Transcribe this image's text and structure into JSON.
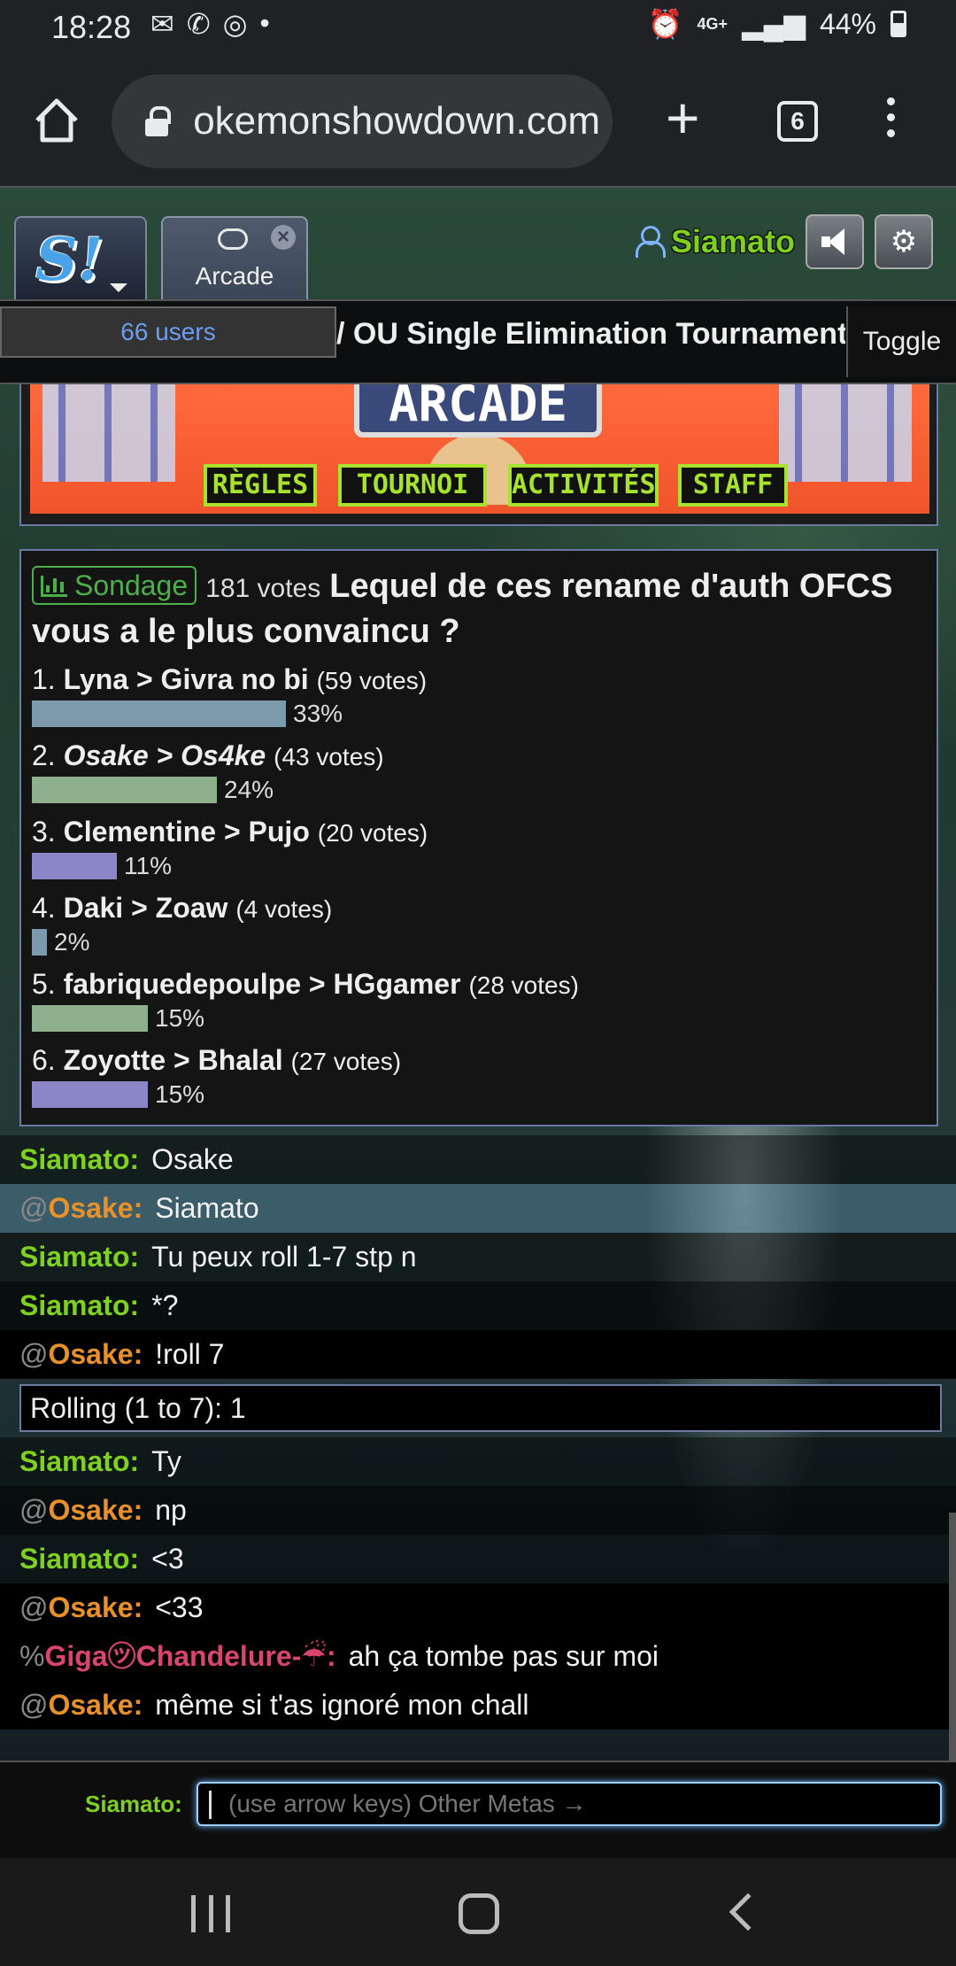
{
  "status_bar": {
    "time": "18:28",
    "notification_icons": [
      "email-icon",
      "whatsapp-icon",
      "instagram-icon",
      "dot-icon"
    ],
    "network": "4G+",
    "battery": "44%"
  },
  "browser": {
    "url": "pokemonshowdown.com",
    "tab_count": "6"
  },
  "showdown": {
    "room_tab": "Arcade",
    "username": "Siamato",
    "users_label": "66 users",
    "tournament_title": "/ OU Single Elimination Tournament",
    "toggle_label": "Toggle",
    "banner": {
      "arcade_label": "ARCADE",
      "buttons": [
        "RÈGLES",
        "TOURNOI",
        "ACTIVITÉS",
        "STAFF"
      ]
    },
    "poll": {
      "badge_label": "Sondage",
      "total_votes": "181 votes",
      "question": "Lequel de ces rename d'auth OFCS vous a le plus convaincu ?",
      "options": [
        {
          "num": "1.",
          "text": "Lyna > Givra no bi",
          "italic": false,
          "votes": "(59 votes)",
          "percent_label": "33%",
          "percent": 33,
          "color": "#7d9aad"
        },
        {
          "num": "2.",
          "text": "Osake > Os4ke",
          "italic": true,
          "votes": "(43 votes)",
          "percent_label": "24%",
          "percent": 24,
          "color": "#8fb08d"
        },
        {
          "num": "3.",
          "text": "Clementine > Pujo",
          "italic": false,
          "votes": "(20 votes)",
          "percent_label": "11%",
          "percent": 11,
          "color": "#8a86c8"
        },
        {
          "num": "4.",
          "text": "Daki > Zoaw",
          "italic": false,
          "votes": "(4 votes)",
          "percent_label": "2%",
          "percent": 2,
          "color": "#7d9aad"
        },
        {
          "num": "5.",
          "text": "fabriquedepoulpe > HGgamer",
          "italic": false,
          "votes": "(28 votes)",
          "percent_label": "15%",
          "percent": 15,
          "color": "#8fb08d"
        },
        {
          "num": "6.",
          "text": "Zoyotte > Bhalal",
          "italic": false,
          "votes": "(27 votes)",
          "percent_label": "15%",
          "percent": 15,
          "color": "#8a86c8"
        }
      ]
    },
    "chat": [
      {
        "rank": "",
        "user": "Siamato",
        "msg": "Osake"
      },
      {
        "rank": "@",
        "user": "Osake",
        "msg": "Siamato"
      },
      {
        "rank": "",
        "user": "Siamato",
        "msg": "Tu peux roll 1-7 stp n"
      },
      {
        "rank": "",
        "user": "Siamato",
        "msg": "*?"
      },
      {
        "rank": "@",
        "user": "Osake",
        "msg": "!roll 7"
      },
      {
        "roll_result": "Rolling (1 to 7): 1"
      },
      {
        "rank": "",
        "user": "Siamato",
        "msg": "Ty"
      },
      {
        "rank": "@",
        "user": "Osake",
        "msg": "np"
      },
      {
        "rank": "",
        "user": "Siamato",
        "msg": "<3"
      },
      {
        "rank": "@",
        "user": "Osake",
        "msg": "<33"
      },
      {
        "rank": "%",
        "user": "Giga㋡Chandelure-☔",
        "msg": "ah ça tombe pas sur moi"
      },
      {
        "rank": "@",
        "user": "Osake",
        "msg": "même si t'as ignoré mon chall"
      }
    ],
    "compose": {
      "label": "Siamato:",
      "placeholder": "(use arrow keys) Other Metas →"
    }
  }
}
